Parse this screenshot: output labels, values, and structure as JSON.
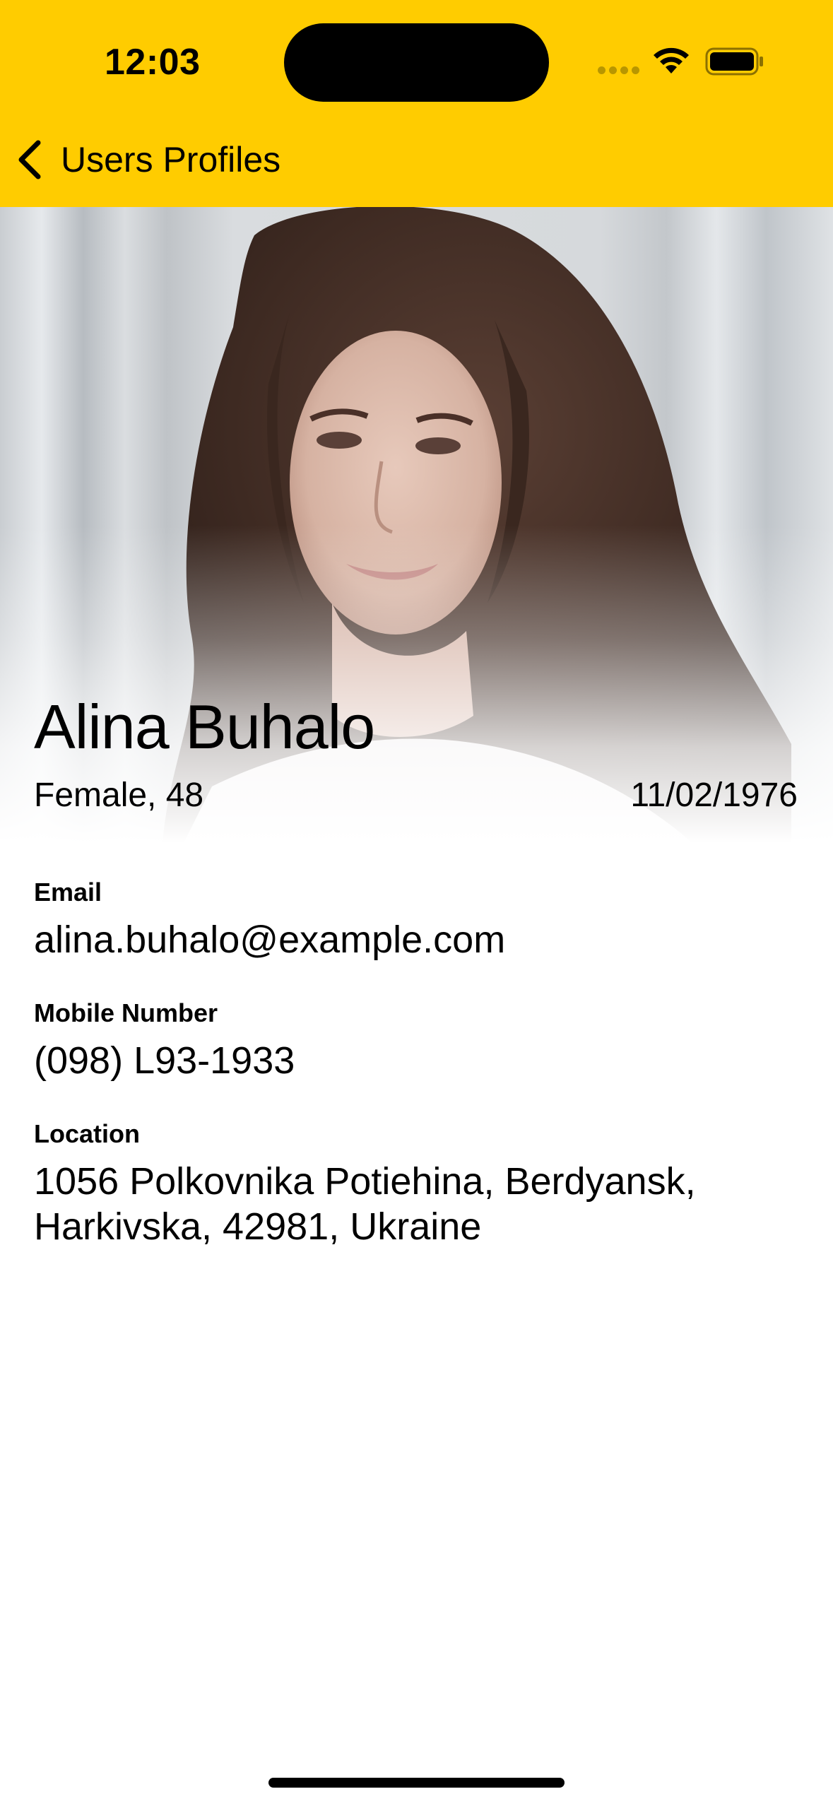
{
  "status_bar": {
    "time": "12:03",
    "icons": [
      "signal-dots-icon",
      "wifi-icon",
      "battery-icon"
    ]
  },
  "nav": {
    "back_label": "Users Profiles",
    "back_icon": "chevron-left-icon",
    "background_color": "#FFCC00"
  },
  "profile": {
    "photo": "profile-photo",
    "name": "Alina Buhalo",
    "gender_age": "Female, 48",
    "date_of_birth": "11/02/1976"
  },
  "details": {
    "email_label": "Email",
    "email_value": "alina.buhalo@example.com",
    "mobile_label": "Mobile Number",
    "mobile_value": "(098) L93-1933",
    "location_label": "Location",
    "location_value": "1056 Polkovnika Potiehina, Berdyansk, Harkivska, 42981, Ukraine"
  }
}
